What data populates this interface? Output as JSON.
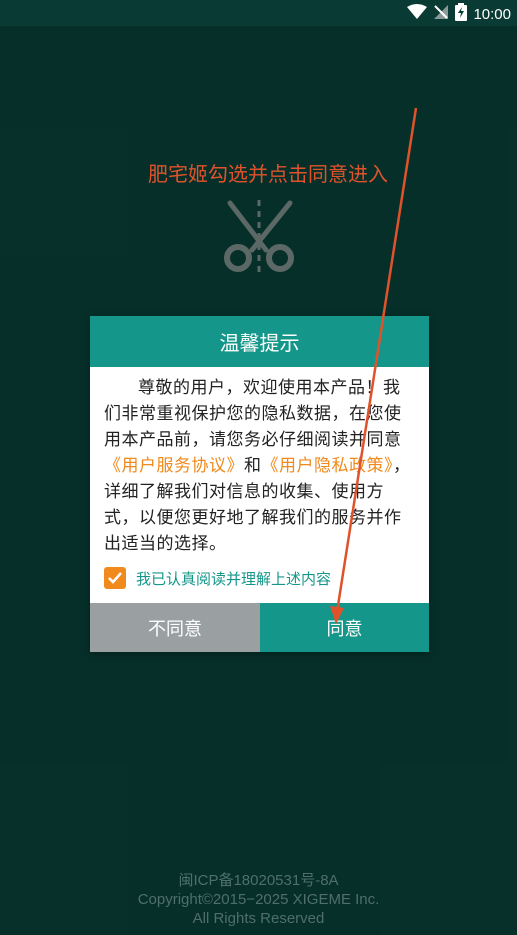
{
  "status_bar": {
    "time": "10:00",
    "icons": [
      "wifi-icon",
      "no-signal-icon",
      "battery-charging-icon"
    ]
  },
  "annotation": {
    "text": "肥宅姬勾选并点击同意进入"
  },
  "background_logo": {
    "icon": "scissors-icon"
  },
  "dialog": {
    "title": "温馨提示",
    "body_part1": "尊敬的用户，欢迎使用本产品！我们非常重视保护您的隐私数据，在您使用本产品前，请您务必仔细阅读并同意",
    "service_link": "《用户服务协议》",
    "and_text": "和",
    "privacy_link": "《用户隐私政策》",
    "body_part2": "，详细了解我们对信息的收集、使用方式，以便您更好地了解我们的服务并作出适当的选择。",
    "checkbox_label": "我已认真阅读并理解上述内容",
    "checkbox_checked": true,
    "disagree_label": "不同意",
    "agree_label": "同意"
  },
  "footer": {
    "icp": "闽ICP备18020531号-8A",
    "copyright": "Copyright©2015−2025 XIGEME Inc.",
    "rights": "All Rights Reserved"
  },
  "colors": {
    "background": "#083a33",
    "accent": "#14978a",
    "link": "#f08a1c",
    "annotation": "#e0532a",
    "disagree_button": "#9aa0a2"
  }
}
